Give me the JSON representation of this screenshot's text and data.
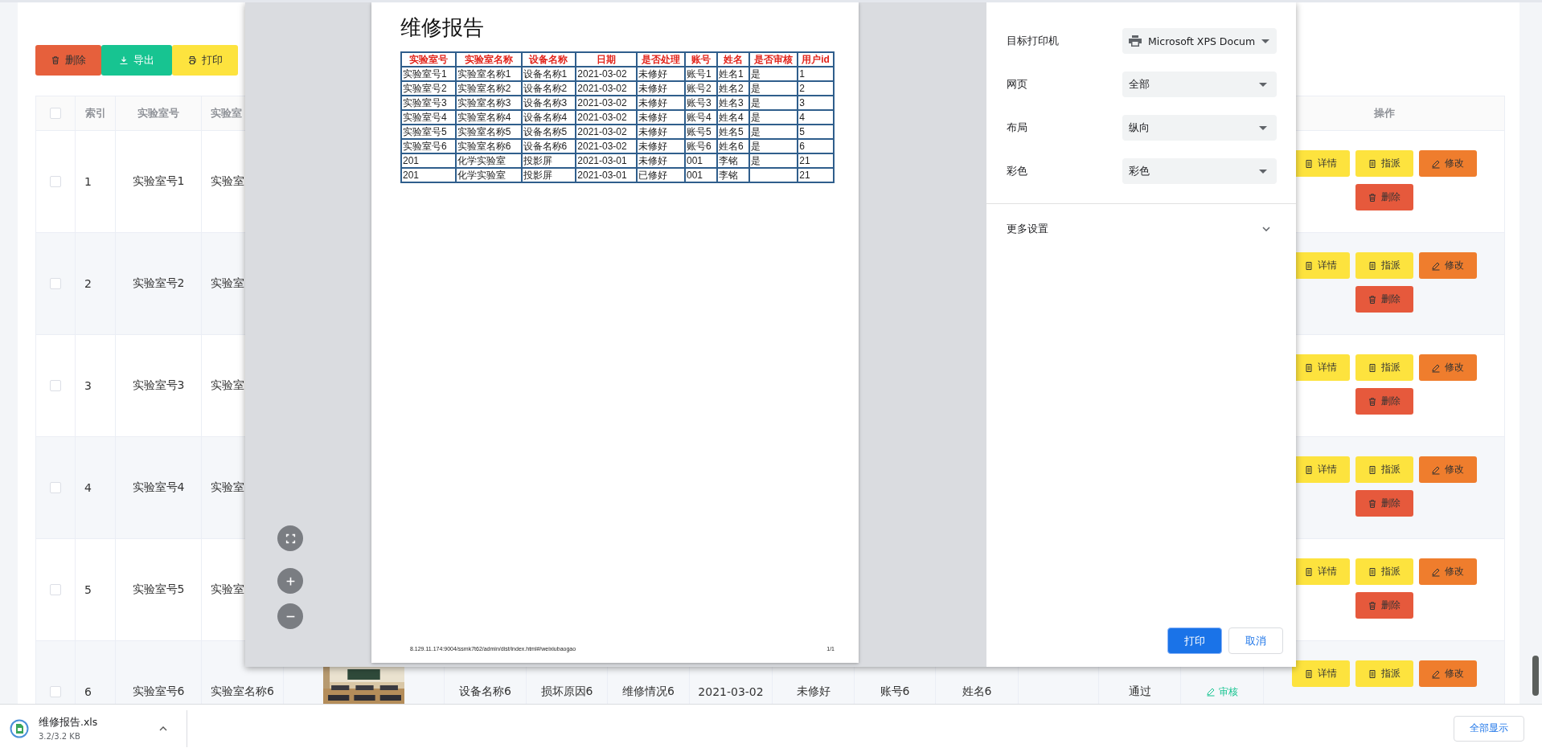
{
  "toolbar": [
    {
      "kind": "delete",
      "label": "删除"
    },
    {
      "kind": "export",
      "label": "导出"
    },
    {
      "kind": "print",
      "label": "打印"
    }
  ],
  "table": {
    "all_checked": false,
    "columns": [
      "索引",
      "实验室号",
      "实验室"
    ],
    "action_column": "操作",
    "rows": [
      {
        "checked": false,
        "cells": [
          {
            "kind": "text",
            "text": "1"
          },
          {
            "kind": "text",
            "text": "实验室号1"
          },
          {
            "kind": "text",
            "text": "实验室"
          }
        ],
        "actions": [
          {
            "kind": "detail",
            "label": "详情"
          },
          {
            "kind": "assign",
            "label": "指派"
          },
          {
            "kind": "edit",
            "label": "修改"
          },
          {
            "kind": "delete",
            "label": "删除"
          }
        ]
      },
      {
        "checked": false,
        "cells": [
          {
            "kind": "text",
            "text": "2"
          },
          {
            "kind": "text",
            "text": "实验室号2"
          },
          {
            "kind": "text",
            "text": "实验室"
          }
        ],
        "actions": [
          {
            "kind": "detail",
            "label": "详情"
          },
          {
            "kind": "assign",
            "label": "指派"
          },
          {
            "kind": "edit",
            "label": "修改"
          },
          {
            "kind": "delete",
            "label": "删除"
          }
        ]
      },
      {
        "checked": false,
        "cells": [
          {
            "kind": "text",
            "text": "3"
          },
          {
            "kind": "text",
            "text": "实验室号3"
          },
          {
            "kind": "text",
            "text": "实验室"
          }
        ],
        "actions": [
          {
            "kind": "detail",
            "label": "详情"
          },
          {
            "kind": "assign",
            "label": "指派"
          },
          {
            "kind": "edit",
            "label": "修改"
          },
          {
            "kind": "delete",
            "label": "删除"
          }
        ]
      },
      {
        "checked": false,
        "cells": [
          {
            "kind": "text",
            "text": "4"
          },
          {
            "kind": "text",
            "text": "实验室号4"
          },
          {
            "kind": "text",
            "text": "实验室"
          }
        ],
        "actions": [
          {
            "kind": "detail",
            "label": "详情"
          },
          {
            "kind": "assign",
            "label": "指派"
          },
          {
            "kind": "edit",
            "label": "修改"
          },
          {
            "kind": "delete",
            "label": "删除"
          }
        ]
      },
      {
        "checked": false,
        "cells": [
          {
            "kind": "text",
            "text": "5"
          },
          {
            "kind": "text",
            "text": "实验室号5"
          },
          {
            "kind": "text",
            "text": "实验室"
          }
        ],
        "actions": [
          {
            "kind": "detail",
            "label": "详情"
          },
          {
            "kind": "assign",
            "label": "指派"
          },
          {
            "kind": "edit",
            "label": "修改"
          },
          {
            "kind": "delete",
            "label": "删除"
          }
        ]
      },
      {
        "checked": false,
        "cells": [
          {
            "kind": "text",
            "text": "6"
          },
          {
            "kind": "text",
            "text": "实验室号6"
          },
          {
            "kind": "text",
            "text": "实验室名称6"
          },
          {
            "kind": "picture"
          },
          {
            "kind": "text",
            "text": "设备名称6"
          },
          {
            "kind": "text",
            "text": "损坏原因6"
          },
          {
            "kind": "text",
            "text": "维修情况6"
          },
          {
            "kind": "text",
            "text": "2021-03-02"
          },
          {
            "kind": "text",
            "text": "未修好"
          },
          {
            "kind": "text",
            "text": "账号6"
          },
          {
            "kind": "text",
            "text": "姓名6"
          },
          {
            "kind": "blank"
          },
          {
            "kind": "text",
            "text": "通过"
          },
          {
            "kind": "link",
            "text": "审核"
          }
        ],
        "actions": [
          {
            "kind": "detail",
            "label": "详情"
          },
          {
            "kind": "assign",
            "label": "指派"
          },
          {
            "kind": "edit",
            "label": "修改"
          }
        ]
      }
    ]
  },
  "print_dialog": {
    "preview": {
      "title": "维修报告",
      "columns": [
        "实验室号",
        "实验室名称",
        "设备名称",
        "日期",
        "是否处理",
        "账号",
        "姓名",
        "是否审核",
        "用户id"
      ],
      "rows": [
        [
          "实验室号1",
          "实验室名称1",
          "设备名称1",
          "2021-03-02",
          "未修好",
          "账号1",
          "姓名1",
          "是",
          "1"
        ],
        [
          "实验室号2",
          "实验室名称2",
          "设备名称2",
          "2021-03-02",
          "未修好",
          "账号2",
          "姓名2",
          "是",
          "2"
        ],
        [
          "实验室号3",
          "实验室名称3",
          "设备名称3",
          "2021-03-02",
          "未修好",
          "账号3",
          "姓名3",
          "是",
          "3"
        ],
        [
          "实验室号4",
          "实验室名称4",
          "设备名称4",
          "2021-03-02",
          "未修好",
          "账号4",
          "姓名4",
          "是",
          "4"
        ],
        [
          "实验室号5",
          "实验室名称5",
          "设备名称5",
          "2021-03-02",
          "未修好",
          "账号5",
          "姓名5",
          "是",
          "5"
        ],
        [
          "实验室号6",
          "实验室名称6",
          "设备名称6",
          "2021-03-02",
          "未修好",
          "账号6",
          "姓名6",
          "是",
          "6"
        ],
        [
          "201",
          "化学实验室",
          "投影屏",
          "2021-03-01",
          "未修好",
          "001",
          "李铭",
          "是",
          "21"
        ],
        [
          "201",
          "化学实验室",
          "投影屏",
          "2021-03-01",
          "已修好",
          "001",
          "李铭",
          null,
          "21"
        ]
      ],
      "footer_url": "8.129.11.174:9004/ssmk7t62/admin/dist/index.html#/weixiubaogao",
      "page_number": "1/1"
    },
    "settings": [
      {
        "label": "目标打印机",
        "value": "Microsoft XPS Docum",
        "kind": "printer"
      },
      {
        "label": "网页",
        "value": "全部",
        "kind": "plain"
      },
      {
        "label": "布局",
        "value": "纵向",
        "kind": "plain"
      },
      {
        "label": "彩色",
        "value": "彩色",
        "kind": "plain"
      }
    ],
    "more_settings": "更多设置",
    "buttons": [
      {
        "kind": "primary",
        "label": "打印"
      },
      {
        "kind": "secondary",
        "label": "取消"
      }
    ]
  },
  "download_bar": {
    "file_name": "维修报告.xls",
    "progress": "3.2/3.2 KB",
    "show_all": "全部显示"
  }
}
